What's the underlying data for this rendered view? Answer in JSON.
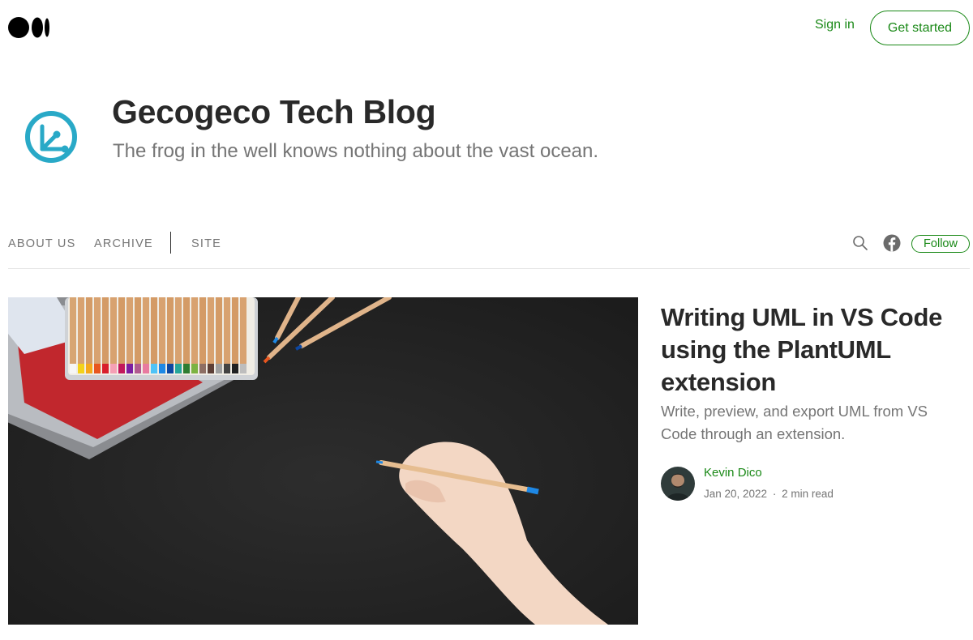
{
  "header": {
    "logo_icon": "medium-logo",
    "sign_in_label": "Sign in",
    "get_started_label": "Get started"
  },
  "blog": {
    "logo_icon": "gecogeco-logo",
    "title": "Gecogeco Tech Blog",
    "tagline": "The frog in the well knows nothing about the vast ocean."
  },
  "nav": {
    "items": [
      {
        "label": "ABOUT US"
      },
      {
        "label": "ARCHIVE"
      },
      {
        "label": "SITE"
      }
    ],
    "search_icon": "search-icon",
    "facebook_icon": "facebook-icon",
    "follow_label": "Follow"
  },
  "article": {
    "title": "Writing UML in VS Code using the PlantUML extension",
    "subtitle": "Write, preview, and export UML from VS Code through an extension.",
    "author": "Kevin Dico",
    "date": "Jan 20, 2022",
    "separator": "·",
    "read_time": "2 min read"
  },
  "colors": {
    "accent_green": "#1a8917",
    "blog_logo_teal": "#29a9c7",
    "text_dark": "#292929",
    "text_muted": "#757575"
  }
}
